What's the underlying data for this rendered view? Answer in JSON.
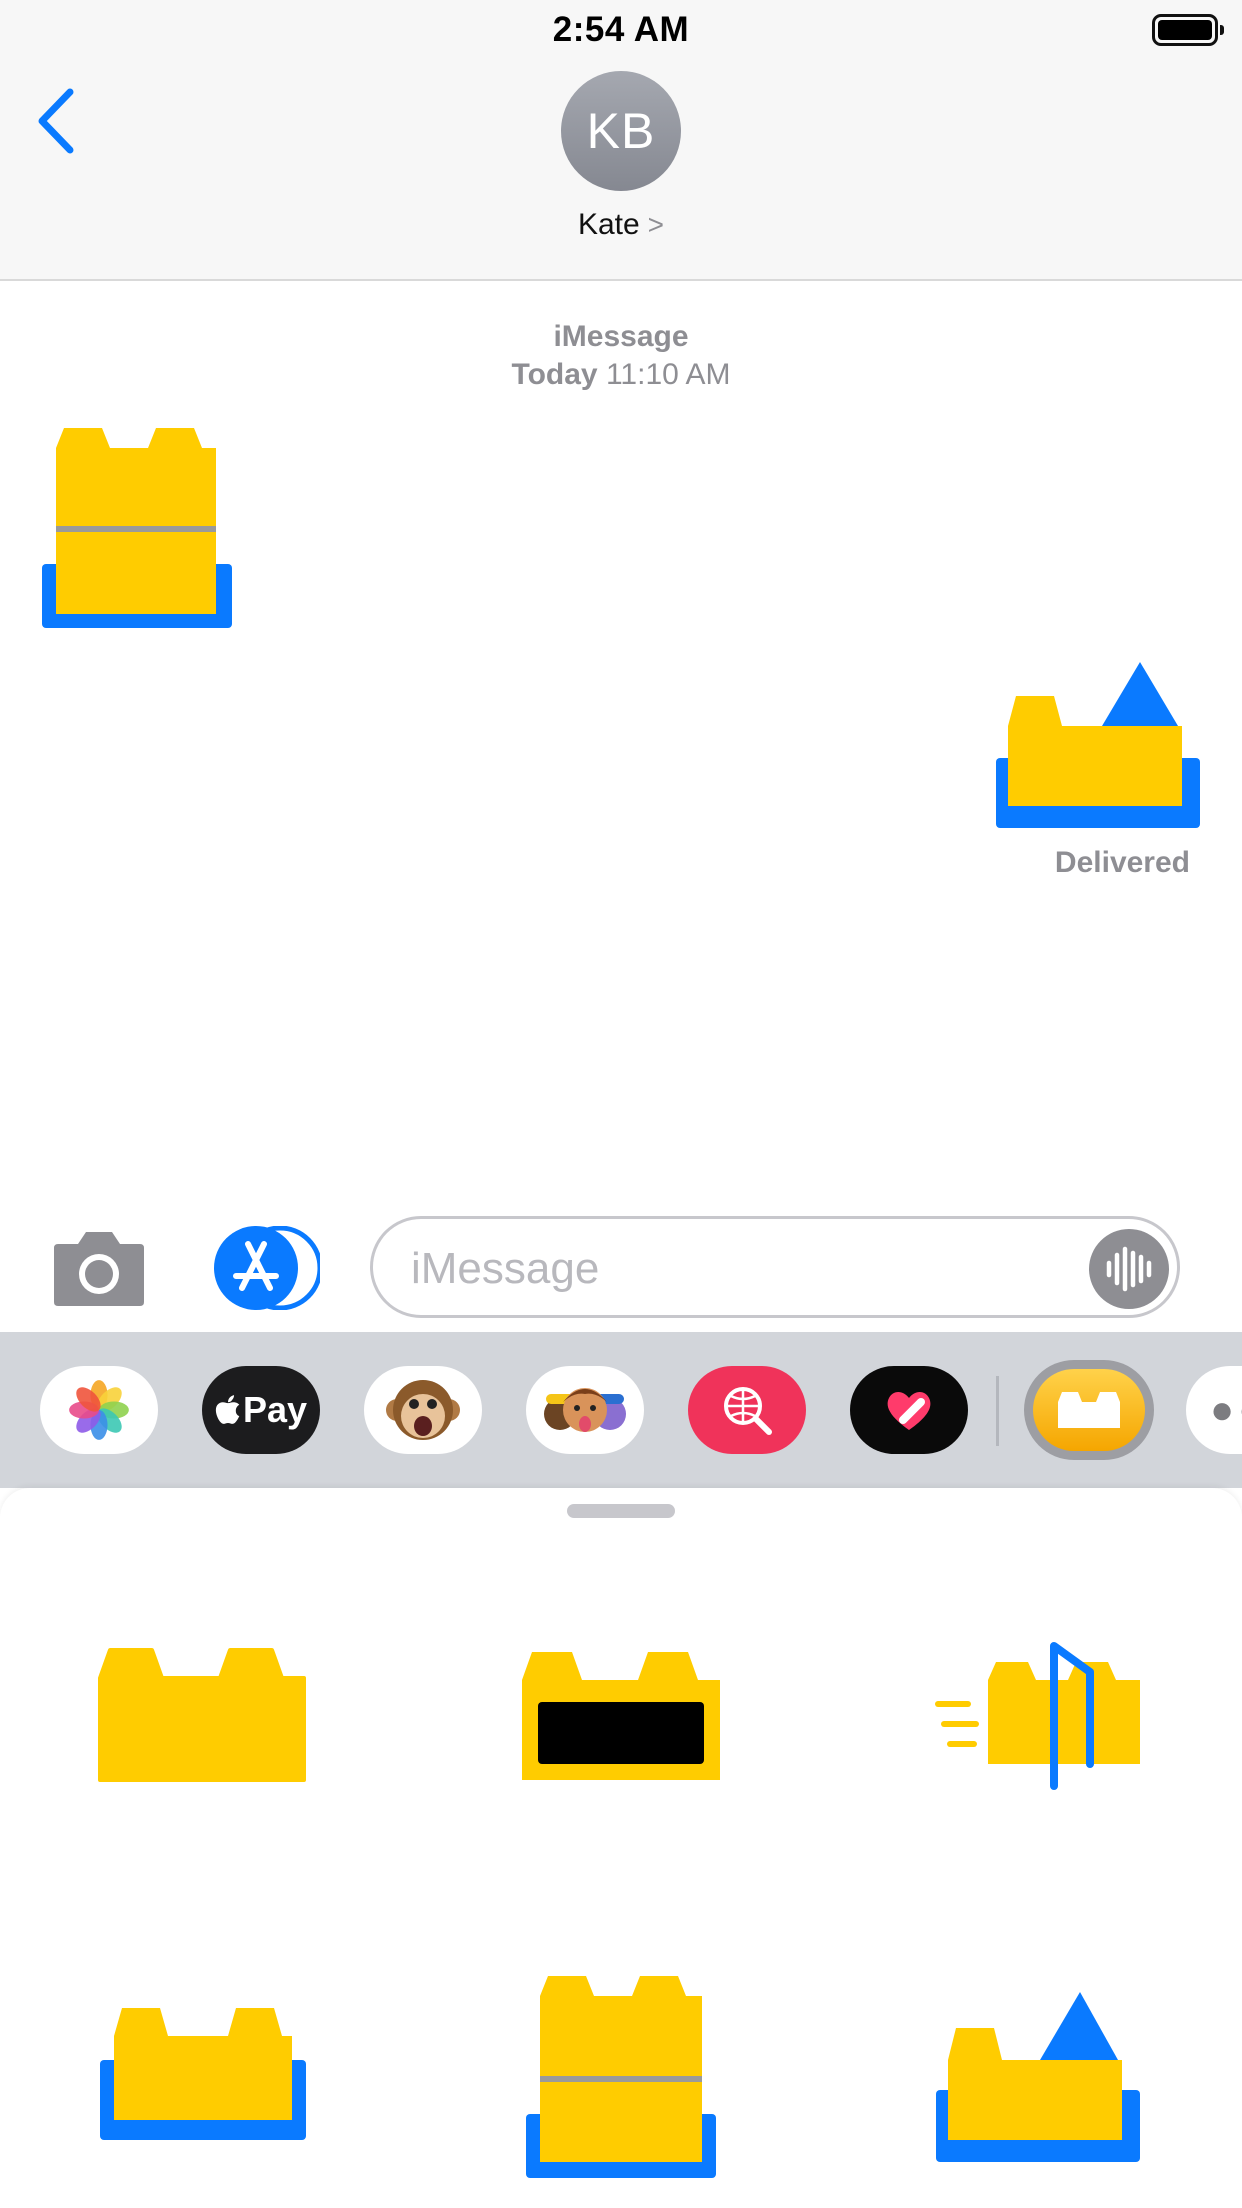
{
  "status_bar": {
    "time": "2:54 AM"
  },
  "header": {
    "avatar_initials": "KB",
    "contact_name": "Kate",
    "chevron": ">"
  },
  "transcript": {
    "service": "iMessage",
    "day": "Today",
    "time": "11:10 AM",
    "delivery_status": "Delivered"
  },
  "input": {
    "placeholder": "iMessage"
  },
  "app_drawer": {
    "items": [
      {
        "name": "photos-app-icon"
      },
      {
        "name": "apple-pay-app-icon",
        "label": "Pay"
      },
      {
        "name": "animoji-app-icon"
      },
      {
        "name": "memoji-stickers-app-icon"
      },
      {
        "name": "image-search-app-icon"
      },
      {
        "name": "digital-touch-app-icon"
      },
      {
        "name": "sticker-app-icon"
      },
      {
        "name": "more-apps-icon"
      }
    ]
  },
  "colors": {
    "accent": "#0a7aff",
    "brick_yellow": "#ffcc00",
    "brick_blue": "#0a7aff"
  },
  "stickers": [
    {
      "name": "yellow-brick-sticker"
    },
    {
      "name": "brick-with-black-window-sticker"
    },
    {
      "name": "speeding-brick-with-flag-sticker"
    },
    {
      "name": "brick-in-blue-tray-sticker"
    },
    {
      "name": "tall-brick-in-blue-tray-sticker"
    },
    {
      "name": "brick-with-blue-triangle-sticker"
    }
  ]
}
